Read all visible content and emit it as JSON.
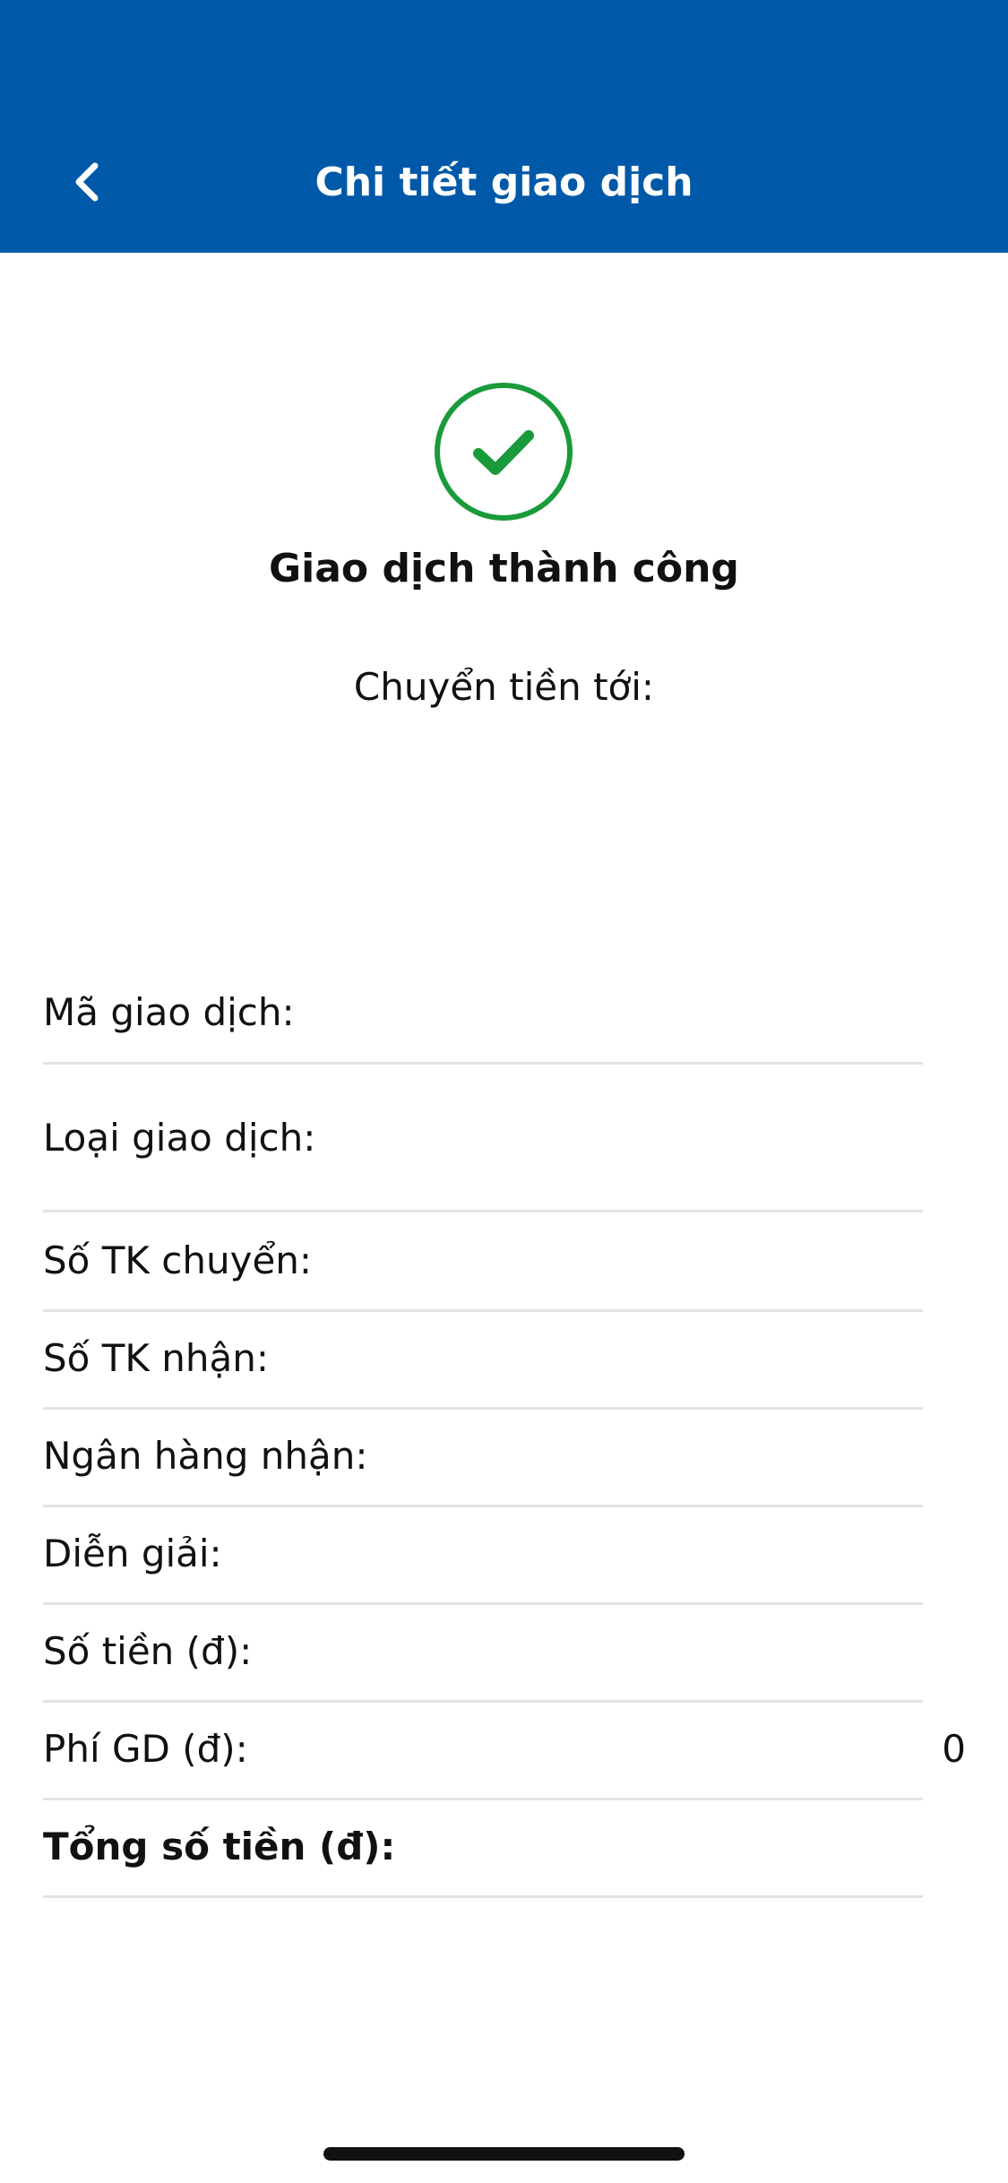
{
  "header": {
    "title": "Chi tiết giao dịch",
    "back_icon": "chevron-left-icon",
    "background": "#0059a8"
  },
  "status": {
    "icon": "check-circle-icon",
    "color": "#1a9a3a",
    "title": "Giao dịch thành công",
    "transfer_to_label": "Chuyển tiền tới:"
  },
  "details": [
    {
      "label": "Mã giao dịch:",
      "value": ""
    },
    {
      "label": "Loại giao dịch:",
      "value": ""
    },
    {
      "label": "Số TK chuyển:",
      "value": ""
    },
    {
      "label": "Số TK nhận:",
      "value": ""
    },
    {
      "label": "Ngân hàng nhận:",
      "value": ""
    },
    {
      "label": "Diễn giải:",
      "value": ""
    },
    {
      "label": "Số tiền (đ):",
      "value": ""
    },
    {
      "label": "Phí GD (đ):",
      "value": "0"
    },
    {
      "label": "Tổng số tiền (đ):",
      "value": ""
    }
  ]
}
